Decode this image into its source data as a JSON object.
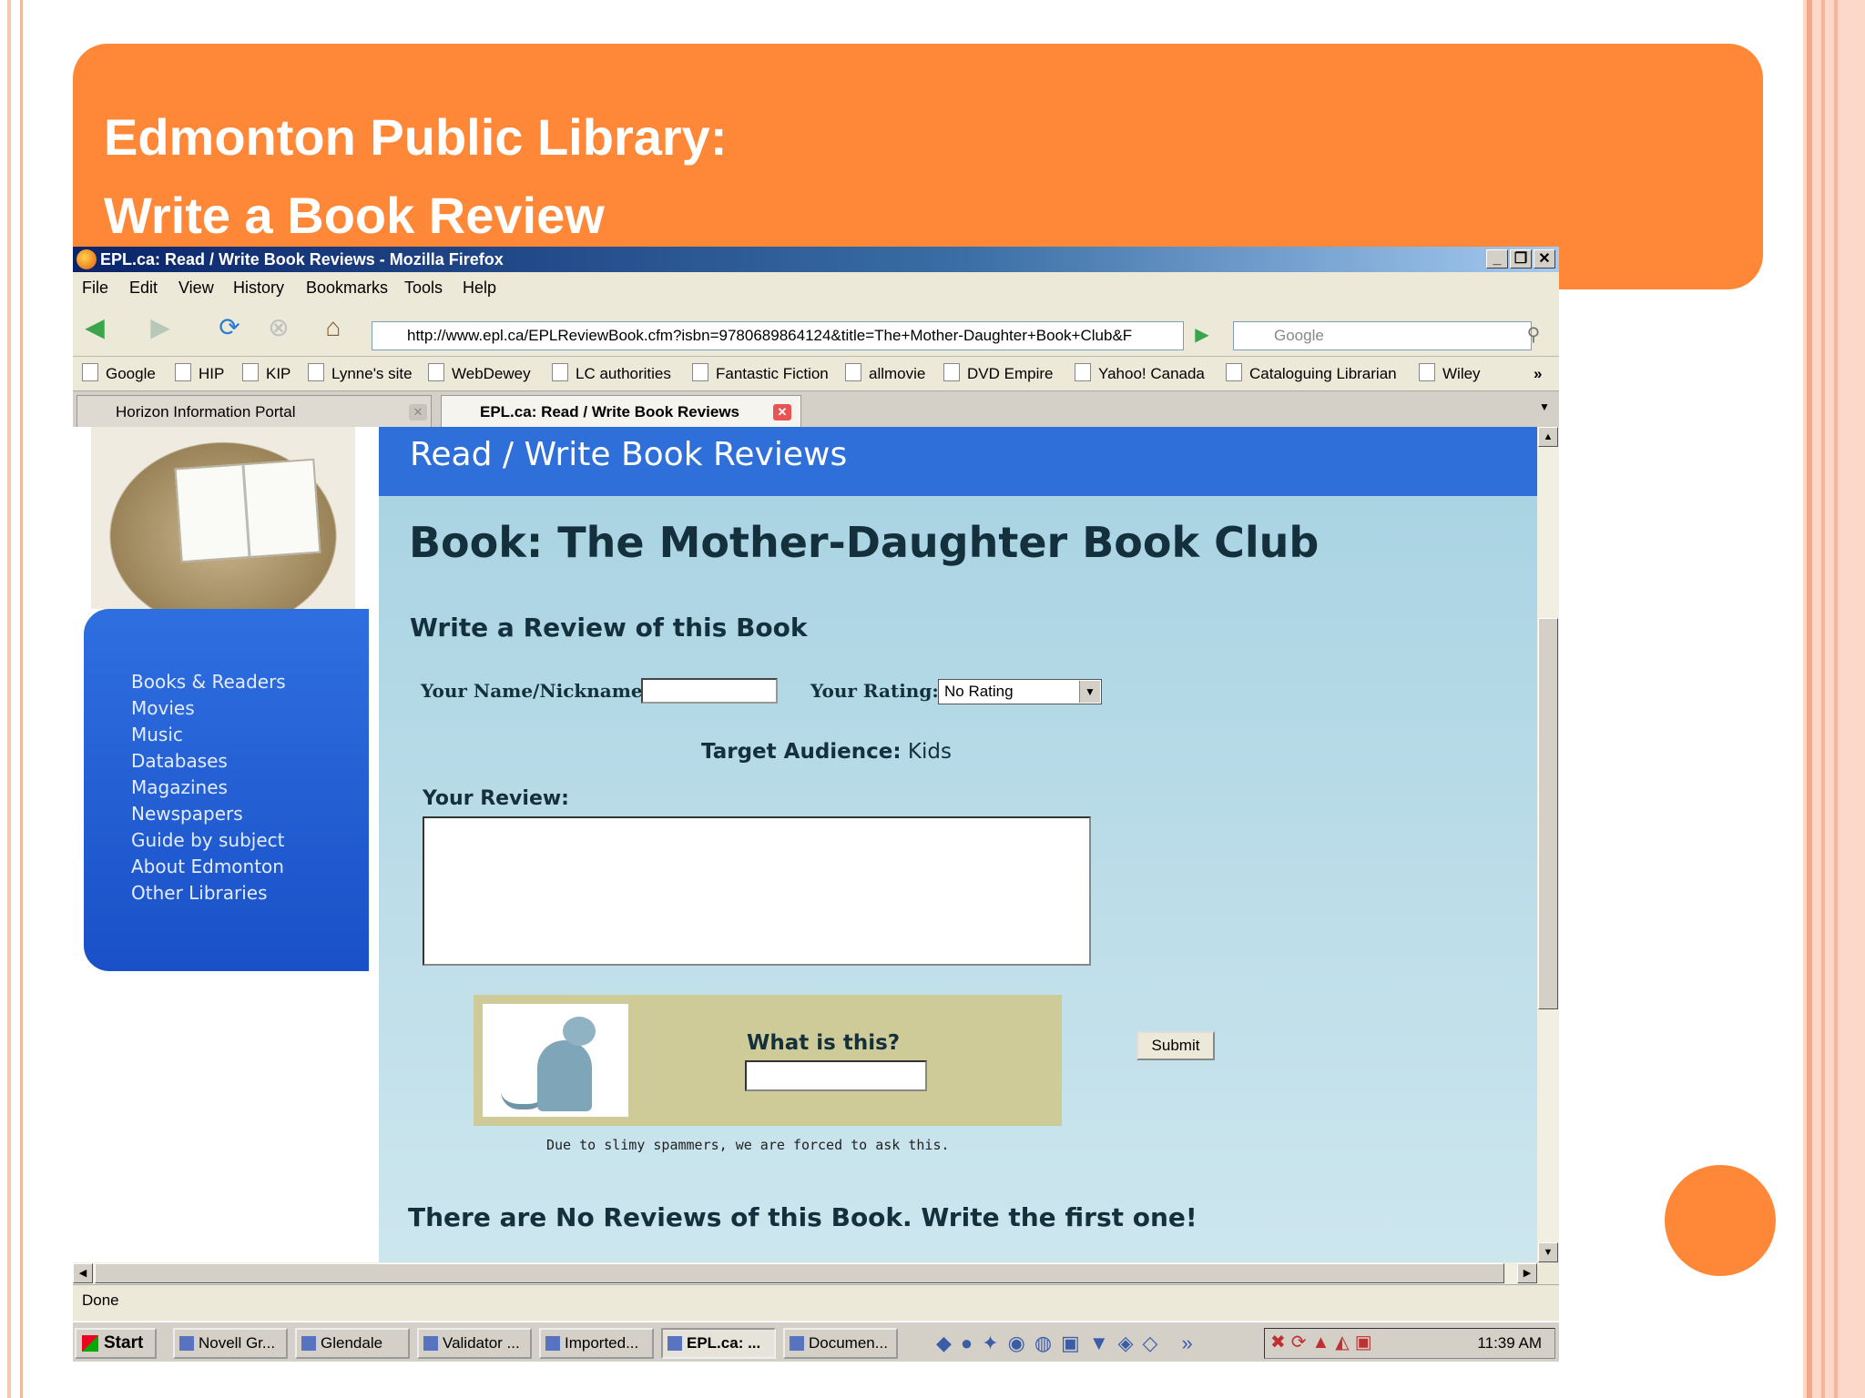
{
  "slide": {
    "title_line1": "Edmonton Public Library:",
    "title_line2": "Write a Book Review",
    "accent": "#fe8837"
  },
  "window": {
    "title": "EPL.ca: Read / Write Book Reviews - Mozilla Firefox"
  },
  "menu": [
    "File",
    "Edit",
    "View",
    "History",
    "Bookmarks",
    "Tools",
    "Help"
  ],
  "toolbar": {
    "url": "http://www.epl.ca/EPLReviewBook.cfm?isbn=9780689864124&title=The+Mother-Daughter+Book+Club&F",
    "search_placeholder": "Google"
  },
  "bookmarks": [
    "Google",
    "HIP",
    "KIP",
    "Lynne's site",
    "WebDewey",
    "LC authorities",
    "Fantastic Fiction",
    "allmovie",
    "DVD Empire",
    "Yahoo! Canada",
    "Cataloguing Librarian",
    "Wiley"
  ],
  "tabs": [
    {
      "label": "Horizon Information Portal"
    },
    {
      "label": "EPL.ca: Read / Write Book Reviews"
    }
  ],
  "page": {
    "header": "Read / Write Book Reviews",
    "book_title": "Book: The Mother-Daughter Book Club",
    "subtitle": "Write a Review of this Book",
    "name_label": "Your Name/Nickname:",
    "rating_label": "Your Rating:",
    "rating_value": "No Rating",
    "audience_label": "Target Audience:",
    "audience_value": "Kids",
    "review_label": "Your Review:",
    "captcha_question": "What is this?",
    "submit_label": "Submit",
    "spam_note": "Due to slimy spammers, we are forced to ask this.",
    "no_reviews": "There are No Reviews of this Book. Write the first one!"
  },
  "leftnav": [
    "Books & Readers",
    "Movies",
    "Music",
    "Databases",
    "Magazines",
    "Newspapers",
    "Guide by subject",
    "About Edmonton",
    "Other Libraries"
  ],
  "status": "Done",
  "taskbar": {
    "start": "Start",
    "items": [
      "Novell Gr...",
      "Glendale",
      "Validator ...",
      "Imported...",
      "EPL.ca: ...",
      "Documen..."
    ],
    "clock": "11:39 AM"
  }
}
